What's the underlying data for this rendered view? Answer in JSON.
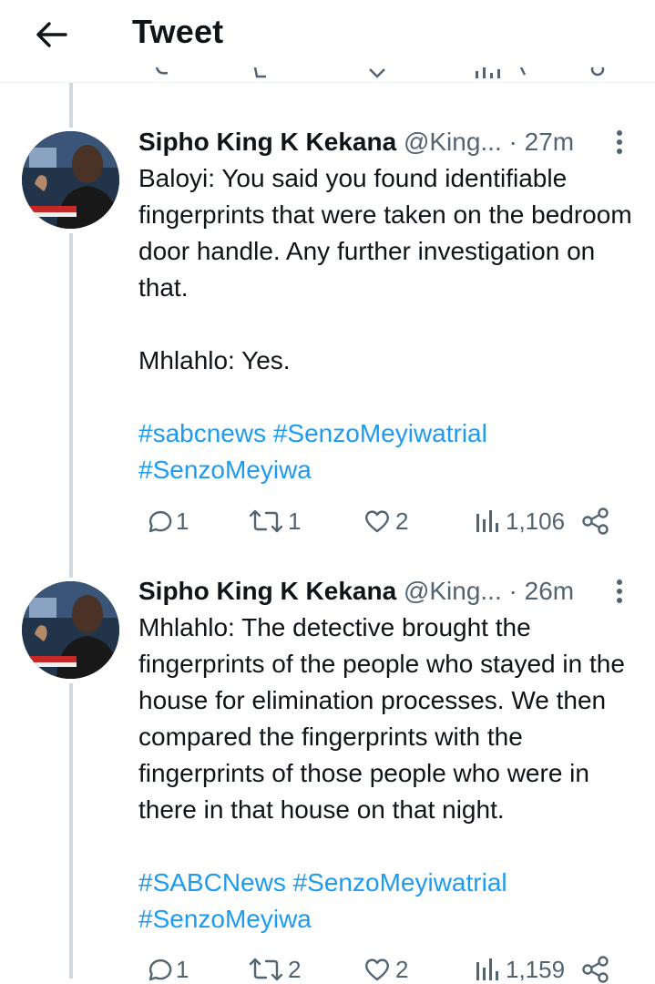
{
  "header": {
    "title": "Tweet",
    "back_icon": "arrow-left-icon"
  },
  "tweets": [
    {
      "author_name": "Sipho King K Kekana",
      "author_handle": "@King...",
      "time": "· 27m",
      "paragraphs": [
        "Baloyi: You said you found identifiable fingerprints that were taken on the bedroom door handle. Any further investigation on that.",
        "Mhlahlo: Yes."
      ],
      "hashtags_line1": "#sabcnews #SenzoMeyiwatrial",
      "hashtags_line2": "#SenzoMeyiwa",
      "replies": "1",
      "retweets": "1",
      "likes": "2",
      "views": "1,106"
    },
    {
      "author_name": "Sipho King K Kekana",
      "author_handle": "@King...",
      "time": "· 26m",
      "paragraphs": [
        "Mhlahlo: The detective brought the fingerprints of the people who stayed in the house for elimination processes. We then compared the fingerprints with the fingerprints of those people who were in there in that house on that night."
      ],
      "hashtags_line1": "#SABCNews #SenzoMeyiwatrial",
      "hashtags_line2": "#SenzoMeyiwa",
      "replies": "1",
      "retweets": "2",
      "likes": "2",
      "views": "1,159"
    }
  ],
  "colors": {
    "link": "#1d9bf0",
    "secondary_text": "#536471",
    "thread_line": "#cfd9de"
  },
  "icons": [
    "arrow-left-icon",
    "more-vertical-icon",
    "reply-icon",
    "retweet-icon",
    "like-icon",
    "views-icon",
    "share-icon"
  ]
}
